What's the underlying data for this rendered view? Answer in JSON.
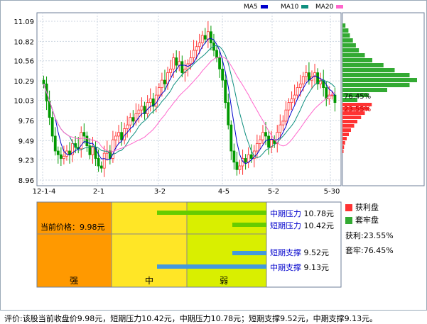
{
  "legend": {
    "ma5": "MA5",
    "ma10": "MA10",
    "ma20": "MA20",
    "ma5_color": "#0000cc",
    "ma10_color": "#0f8f7f",
    "ma20_color": "#ff66cc"
  },
  "chart_data": {
    "type": "candlestick",
    "yticks": [
      "11.09",
      "10.82",
      "10.56",
      "10.29",
      "10.03",
      "9.76",
      "9.49",
      "9.23",
      "8.96"
    ],
    "ylim": [
      8.96,
      11.09
    ],
    "xticks": [
      "12-1-4",
      "2-1",
      "3-2",
      "4-5",
      "5-2",
      "5-30"
    ],
    "series_note": "daily k-line with MA5 MA10 MA20",
    "close": [
      10.25,
      10.02,
      9.8,
      9.55,
      9.35,
      9.3,
      9.25,
      9.28,
      9.35,
      9.3,
      9.45,
      9.4,
      9.38,
      9.6,
      9.55,
      9.42,
      9.3,
      9.4,
      9.25,
      9.15,
      9.12,
      9.32,
      9.35,
      9.25,
      9.5,
      9.55,
      9.6,
      9.5,
      9.65,
      9.7,
      9.8,
      9.75,
      9.85,
      9.9,
      9.95,
      9.85,
      10.0,
      10.05,
      9.95,
      10.1,
      10.2,
      10.3,
      10.25,
      10.4,
      10.45,
      10.6,
      10.5,
      10.55,
      10.4,
      10.45,
      10.52,
      10.6,
      10.7,
      10.75,
      10.8,
      10.9,
      10.85,
      10.95,
      10.8,
      10.7,
      10.6,
      10.45,
      10.3,
      10.0,
      9.7,
      9.35,
      9.2,
      9.1,
      9.15,
      9.25,
      9.2,
      9.3,
      9.25,
      9.35,
      9.45,
      9.5,
      9.6,
      9.55,
      9.4,
      9.5,
      9.45,
      9.6,
      9.7,
      9.75,
      9.9,
      10.0,
      10.05,
      10.1,
      10.2,
      10.25,
      10.35,
      10.4,
      10.3,
      10.35,
      10.4,
      10.25,
      10.3,
      10.2,
      10.05,
      10.1,
      10.1,
      10.0
    ],
    "cost_distribution": {
      "profit_pct_label": "76.45%",
      "trapped_pct_label": "23.55%",
      "profit": [
        4,
        8,
        10,
        14,
        18,
        22,
        30,
        40,
        55,
        70,
        90,
        100,
        90,
        60,
        35,
        20
      ],
      "trapped": [
        55,
        50,
        42,
        35,
        28,
        22,
        16,
        12,
        8,
        5,
        3,
        2
      ]
    },
    "zones": {
      "labels": [
        "强",
        "中",
        "弱"
      ],
      "colors": [
        "#ff9900",
        "#ffe626",
        "#d9ef00"
      ],
      "levels": [
        {
          "label": "中期压力",
          "value": "10.78元",
          "bar_color": "#66cc00",
          "value_num": 10.78
        },
        {
          "label": "短期压力",
          "value": "10.42元",
          "bar_color": "#66cc00",
          "value_num": 10.42
        },
        {
          "label": "短期支撑",
          "value": "9.52元",
          "bar_color": "#4499dd",
          "value_num": 9.52
        },
        {
          "label": "中期支撑",
          "value": "9.13元",
          "bar_color": "#4499dd",
          "value_num": 9.13
        }
      ],
      "current_price_label": "当前价格：",
      "current_price_value": "9.98元"
    }
  },
  "side": {
    "profit_label": "获利盘",
    "trapped_label": "套牢盘",
    "profit_line": "获利:23.55%",
    "trapped_line": "套牢:76.45%",
    "profit_color": "#ff3333",
    "trapped_color": "#33aa33"
  },
  "footer": "评价:该股当前收盘价9.98元，短期压力10.42元，中期压力10.78元；短期支撑9.52元，中期支撑9.13元。"
}
